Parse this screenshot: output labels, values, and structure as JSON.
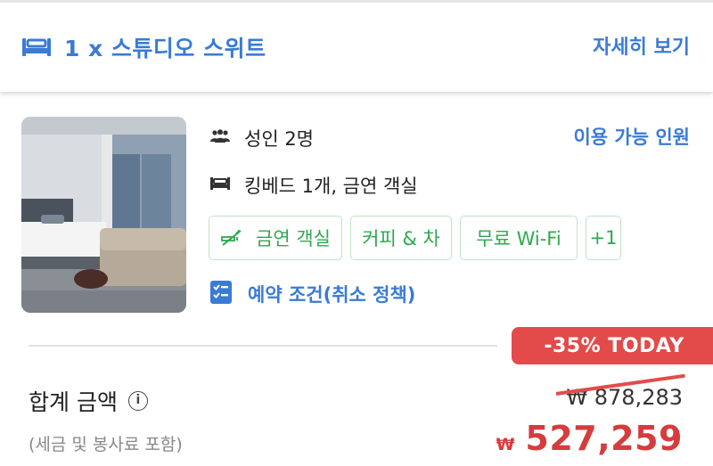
{
  "header": {
    "room_title": "1 x 스튜디오 스위트",
    "details_link": "자세히 보기"
  },
  "room": {
    "occupancy_text": "성인 2명",
    "occupancy_link": "이용 가능 인원",
    "bed_text": "킹베드 1개, 금연 객실",
    "amenities": [
      "금연 객실",
      "커피 & 차",
      "무료 Wi-Fi",
      "+1"
    ],
    "policy_link": "예약 조건(취소 정책)"
  },
  "pricing": {
    "discount_badge": "-35% TODAY",
    "total_label": "합계 금액",
    "info_glyph": "i",
    "tax_note": "(세금 및 봉사료 포함)",
    "original_price": "₩ 878,283",
    "currency_symbol": "₩",
    "final_price": "527,259"
  },
  "colors": {
    "brand_blue": "#3a7bd5",
    "amenity_green": "#2fa84f",
    "discount_red": "#e34b4b"
  },
  "icons": [
    "bed-icon",
    "group-icon",
    "bed-small-icon",
    "no-smoking-icon",
    "checklist-icon",
    "info-icon"
  ]
}
